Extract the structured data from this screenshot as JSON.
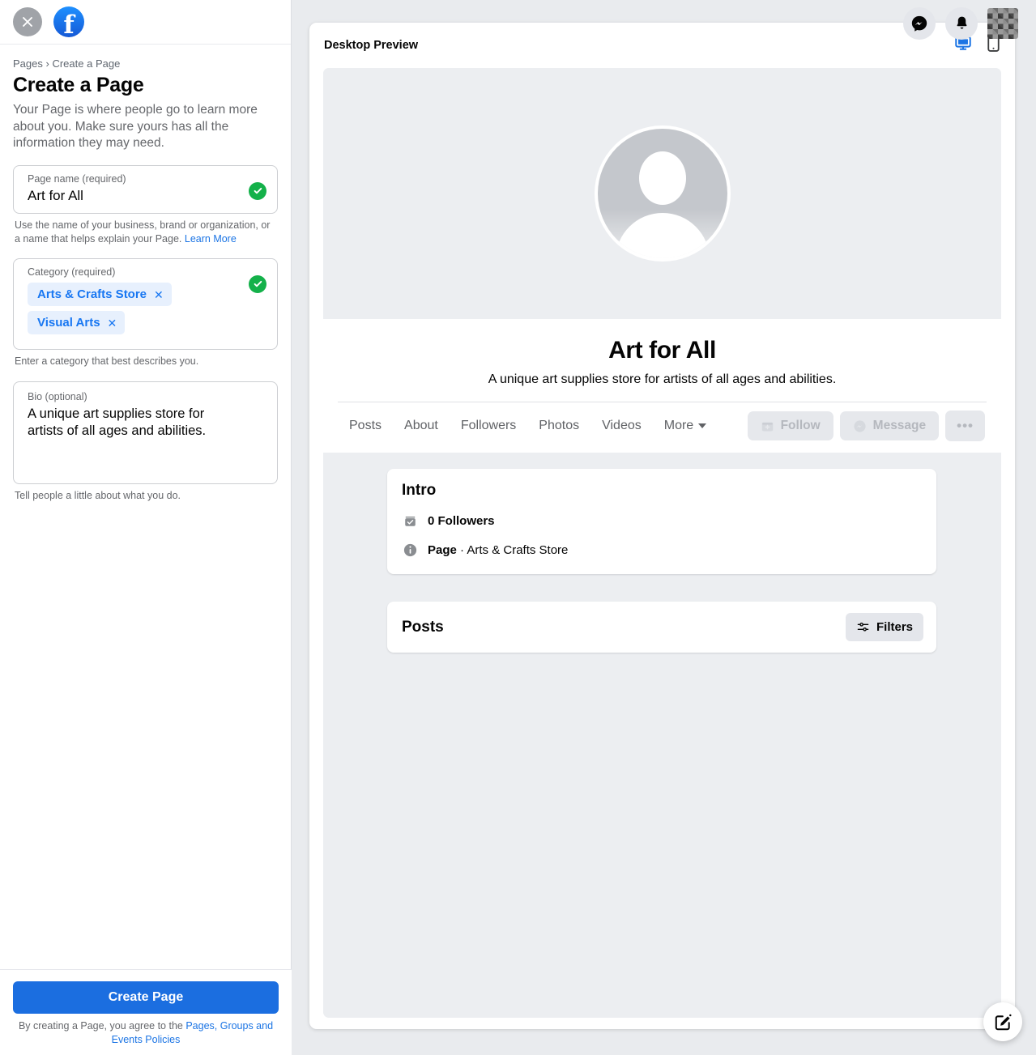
{
  "sidebar": {
    "close_icon": "close-icon",
    "brand_icon": "facebook-logo-icon",
    "breadcrumb_root": "Pages",
    "breadcrumb_sep": "›",
    "breadcrumb_current": "Create a Page",
    "title": "Create a Page",
    "description": "Your Page is where people go to learn more about you. Make sure yours has all the information they may need.",
    "fields": {
      "name": {
        "label": "Page name (required)",
        "value": "Art for All",
        "help_text": "Use the name of your business, brand or organization, or a name that helps explain your Page.",
        "help_link": "Learn More",
        "valid_icon": "check-circle-icon"
      },
      "category": {
        "label": "Category (required)",
        "chips": [
          {
            "label": "Arts & Crafts Store",
            "remove_icon": "✕"
          },
          {
            "label": "Visual Arts",
            "remove_icon": "✕"
          }
        ],
        "help_text": "Enter a category that best describes you.",
        "valid_icon": "check-circle-icon"
      },
      "bio": {
        "label": "Bio (optional)",
        "value": "A unique art supplies store for artists of all ages and abilities.",
        "help_text": "Tell people a little about what you do."
      }
    },
    "footer": {
      "create_button": "Create Page",
      "terms_prefix": "By creating a Page, you agree to the ",
      "terms_link": "Pages, Groups and Events Policies"
    }
  },
  "topbar": {
    "messenger_icon": "messenger-icon",
    "notifications_icon": "bell-icon",
    "avatar": "account-avatar"
  },
  "preview": {
    "title": "Desktop Preview",
    "devices": [
      {
        "name": "desktop-preview-icon",
        "active": true
      },
      {
        "name": "mobile-preview-icon",
        "active": false
      }
    ],
    "page": {
      "avatar_icon": "default-profile-avatar-icon",
      "name": "Art for All",
      "bio": "A unique art supplies store for artists of all ages and abilities.",
      "tabs": [
        {
          "label": "Posts"
        },
        {
          "label": "About"
        },
        {
          "label": "Followers"
        },
        {
          "label": "Photos"
        },
        {
          "label": "Videos"
        },
        {
          "label": "More",
          "has_caret": true
        }
      ],
      "actions": [
        {
          "label": "Follow",
          "icon": "follow-plus-icon",
          "disabled": true
        },
        {
          "label": "Message",
          "icon": "messenger-icon",
          "disabled": true
        },
        {
          "label": "•••",
          "icon": "more-options-icon",
          "disabled": true
        }
      ],
      "intro": {
        "title": "Intro",
        "rows": [
          {
            "icon": "followers-icon",
            "text": "0 Followers",
            "bold": "0 Followers",
            "rest": ""
          },
          {
            "icon": "info-icon",
            "text": "Page · Arts & Crafts Store",
            "bold": "Page",
            "rest": " · Arts & Crafts Store"
          }
        ]
      },
      "posts": {
        "title": "Posts",
        "filters_label": "Filters",
        "filters_icon": "filters-icon"
      }
    },
    "fab_icon": "compose-edit-icon"
  },
  "colors": {
    "brand_blue": "#1877f2",
    "button_blue": "#1b6ee0",
    "link_blue": "#1b74e4",
    "valid_green": "#14b14a",
    "chip_bg": "#e7f0fd",
    "page_bg": "#eceef1"
  }
}
